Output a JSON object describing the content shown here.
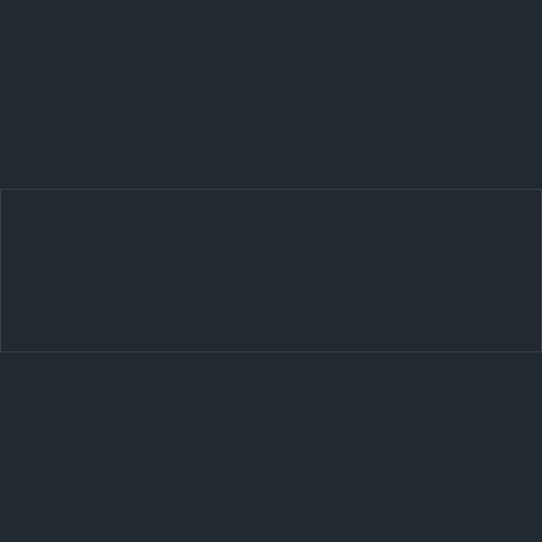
{
  "screen": {
    "background_color": "#222a31",
    "panel_border_color": "#3a444d",
    "panels": [
      {
        "name": "top-area",
        "content": ""
      },
      {
        "name": "middle-panel",
        "content": ""
      },
      {
        "name": "bottom-area",
        "content": ""
      }
    ]
  }
}
